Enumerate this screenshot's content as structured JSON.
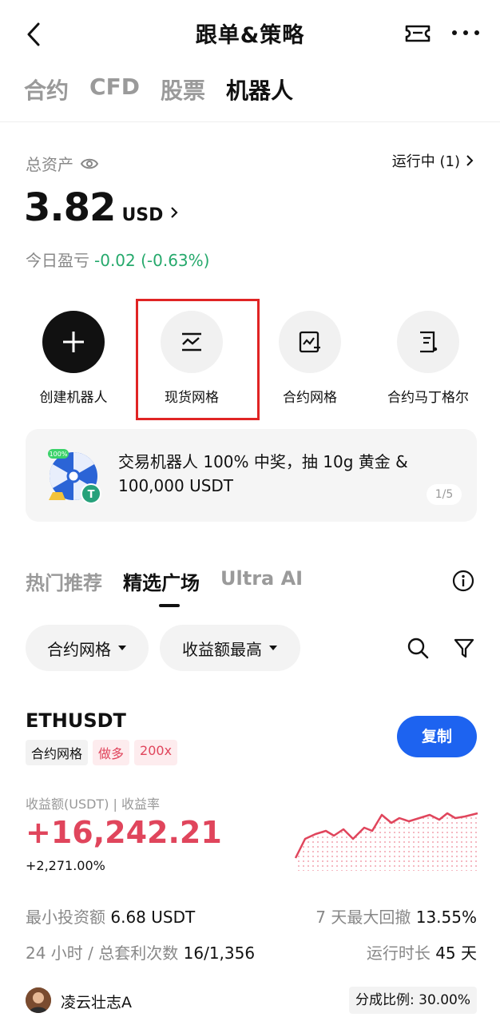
{
  "header": {
    "title": "跟单&策略"
  },
  "top_tabs": [
    "合约",
    "CFD",
    "股票",
    "机器人"
  ],
  "assets": {
    "label": "总资产",
    "running": "运行中 (1)",
    "value": "3.82",
    "unit": "USD",
    "pnl_label": "今日盈亏",
    "pnl_value": "-0.02 (-0.63%)"
  },
  "bots": [
    "创建机器人",
    "现货网格",
    "合约网格",
    "合约马丁格尔"
  ],
  "banner": {
    "text": "交易机器人 100% 中奖，抽 10g 黄金 & 100,000 USDT",
    "page": "1/5",
    "badge": "100%"
  },
  "sub_tabs": [
    "热门推荐",
    "精选广场",
    "Ultra AI"
  ],
  "filters": {
    "type": "合约网格",
    "sort": "收益额最高"
  },
  "strategy": {
    "pair": "ETHUSDT",
    "tags": [
      "合约网格",
      "做多",
      "200x"
    ],
    "copy_label": "复制",
    "profit_label": "收益额(USDT) | 收益率",
    "profit": "+16,242.21",
    "rate": "+2,271.00%",
    "stats": {
      "min_invest_label": "最小投资额",
      "min_invest_value": "6.68 USDT",
      "drawdown_label": "7 天最大回撤",
      "drawdown_value": "13.55%",
      "arb_label": "24 小时 / 总套利次数",
      "arb_value": "16/1,356",
      "runtime_label": "运行时长",
      "runtime_value": "45 天"
    },
    "trader": "凌云壮志A",
    "share": "分成比例: 30.00%"
  },
  "colors": {
    "accent": "#1d63f0",
    "up": "#26a96c",
    "down": "#e0455c",
    "highlight": "#e02424"
  }
}
